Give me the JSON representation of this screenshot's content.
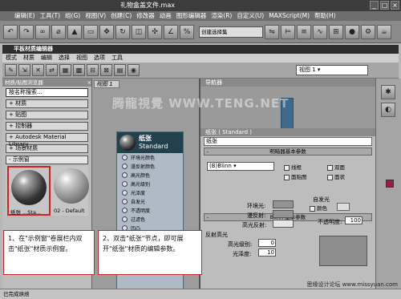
{
  "app": {
    "title": "礼物盒盖文件.max",
    "menu": [
      "编辑(E)",
      "工具(T)",
      "组(G)",
      "视图(V)",
      "创建(C)",
      "修改器",
      "动画",
      "图形编辑器",
      "渲染(R)",
      "自定义(U)",
      "MAXScript(M)",
      "帮助(H)"
    ],
    "selection_set": "创建选择集"
  },
  "editor": {
    "title": "平板材质编辑器",
    "menu": [
      "模式",
      "材质",
      "编辑",
      "选择",
      "视图",
      "选项",
      "工具"
    ],
    "view_dropdown": "视图 1"
  },
  "browser": {
    "header": "材质/贴图浏览器",
    "search_placeholder": "按名称搜索...",
    "rollouts": [
      "+ 材质",
      "+ 贴图",
      "+ 控制器",
      "+ Autodesk Material Library",
      "+ 场景材质"
    ],
    "sample_slots_label": "- 示例窗",
    "thumbs": [
      "纸张 ...Sta...",
      "02 - Default"
    ]
  },
  "view": {
    "tab": "视图 1",
    "node": {
      "name": "纸张",
      "type": "Standard",
      "slots": [
        "环境光颜色",
        "漫反射颜色",
        "高光颜色",
        "高光级别",
        "光泽度",
        "自发光",
        "不透明度",
        "过滤色",
        "凹凸",
        "反射",
        "折射",
        "置换"
      ]
    }
  },
  "navigator": {
    "header": "导航器"
  },
  "props": {
    "header": "纸张 ( Standard )",
    "name_value": "纸张",
    "shader_rollout": "明暗器基本参数",
    "shader": "(B)Blinn",
    "checkboxes": [
      "线框",
      "双面",
      "面贴图",
      "面状"
    ],
    "blinn_rollout": "Blinn 基本参数",
    "self_illum": "自发光",
    "color_label": "颜色",
    "ambient": "环境光:",
    "diffuse": "漫反射:",
    "specular": "高光反射:",
    "opacity_label": "不透明度:",
    "opacity_value": "100",
    "highlight_section": "反射高光",
    "spec_level": "高光级别:",
    "spec_level_value": "0",
    "glossiness": "光泽度:",
    "glossiness_value": "10"
  },
  "status": "已完成烘焙",
  "notes": {
    "note1": "1、在\"示例窗\"卷展栏内双击\"纸张\"材质示例窗。",
    "note2": "2、双击\"纸张\"节点，即可展开\"纸张\"材质的编辑参数。"
  },
  "watermark": "腾龍視覺 WWW.TENG.NET",
  "watermark2": "思缘设计论坛 www.missyuan.com",
  "colors": {
    "highlight": "#d02424",
    "node_header": "#23404d",
    "swatch": "#a01848"
  }
}
